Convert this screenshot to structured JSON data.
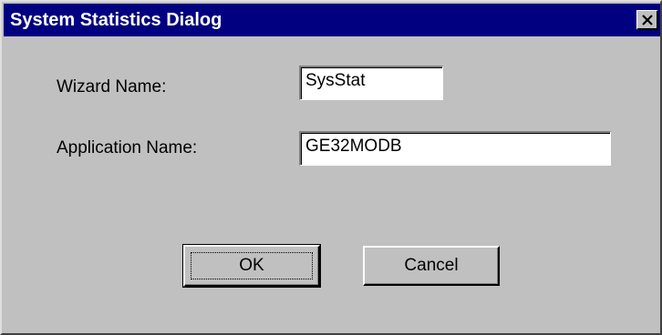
{
  "window": {
    "title": "System Statistics Dialog",
    "close_glyph": "✕",
    "icons": {
      "close": "close-icon"
    }
  },
  "form": {
    "wizard_name_label": "Wizard Name:",
    "wizard_name_value": "SysStat",
    "application_name_label": "Application Name:",
    "application_name_value": "GE32MODB"
  },
  "buttons": {
    "ok_label": "OK",
    "cancel_label": "Cancel"
  },
  "colors": {
    "titlebar": "#000080",
    "dialog_face": "#c0c0c0",
    "field_background": "#ffffff"
  }
}
